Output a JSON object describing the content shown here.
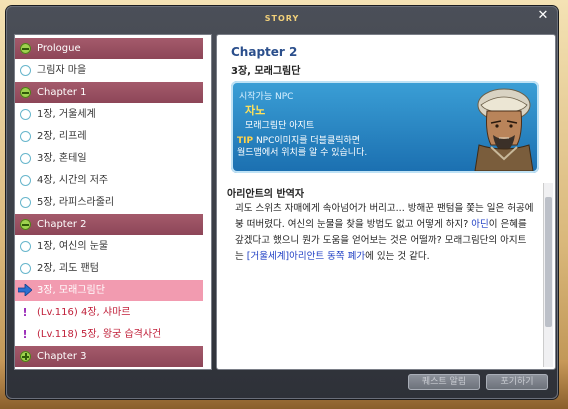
{
  "window": {
    "title": "STORY",
    "close": "✕"
  },
  "list": [
    {
      "kind": "header",
      "text": "Prologue"
    },
    {
      "kind": "item",
      "text": "그림자 마을"
    },
    {
      "kind": "header",
      "text": "Chapter 1"
    },
    {
      "kind": "item",
      "text": "1장, 거울세계"
    },
    {
      "kind": "item",
      "text": "2장, 리프레"
    },
    {
      "kind": "item",
      "text": "3장, 혼테일"
    },
    {
      "kind": "item",
      "text": "4장, 시간의 저주"
    },
    {
      "kind": "item",
      "text": "5장, 라피스라줄리"
    },
    {
      "kind": "header",
      "text": "Chapter 2"
    },
    {
      "kind": "item",
      "text": "1장, 여신의 눈물"
    },
    {
      "kind": "item",
      "text": "2장, 괴도 팬텀"
    },
    {
      "kind": "selected",
      "text": "3장, 모래그림단"
    },
    {
      "kind": "quest",
      "text": "(Lv.116) 4장, 샤마르"
    },
    {
      "kind": "quest",
      "text": "(Lv.118) 5장, 왕궁 습격사건"
    },
    {
      "kind": "header_plus",
      "text": "Chapter 3"
    }
  ],
  "detail": {
    "chapter": "Chapter 2",
    "subtitle": "3장, 모래그림단",
    "npc_role": "시작가능 NPC",
    "npc_name": "자노",
    "npc_org": "모래그림단 아지트",
    "tip_label": "TIP",
    "tip_text_1": " NPC이미지를 더블클릭하면",
    "tip_text_2": "월드맵에서 위치를 알 수 있습니다.",
    "story_title": "아리안트의 반역자",
    "story_p1": "괴도 스위츠 자매에게 속아넘어가 버리고... 방해꾼 팬텀을 쫓는 일은 허공에 붕 떠버렸다. 여신의 눈물을 찾을 방법도 없고 어떻게 하지? ",
    "story_hl1": "아딘",
    "story_p2": "이 은혜를 갚겠다고 했으니 뭔가 도움을 얻어보는 것은 어떨까? 모래그림단의 아지트는 ",
    "story_hl2": "[거울세계]아리안트 동쪽 폐가",
    "story_p3": "에 있는 것 같다."
  },
  "buttons": {
    "left": "퀘스트 알림",
    "right": "포기하기"
  },
  "colors": {
    "header": "#98505f",
    "selected": "#f29bb0",
    "npc_box": "#2a86c4",
    "highlight": "#1f3fc4"
  }
}
